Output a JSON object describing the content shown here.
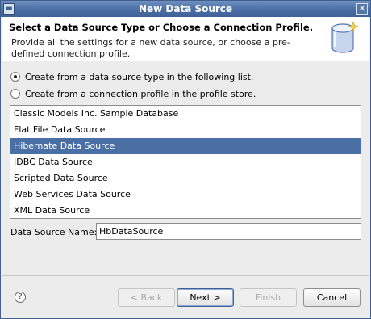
{
  "window": {
    "title": "New Data Source"
  },
  "header": {
    "heading": "Select a Data Source Type or Choose a Connection Profile.",
    "description": "Provide all the settings for a new data source, or choose a pre-defined connection profile.",
    "icon": "database-icon"
  },
  "options": {
    "create_from_type": "Create from a data source type in the following list.",
    "create_from_profile": "Create from a connection profile in the profile store.",
    "selected": "create_from_type"
  },
  "sources": {
    "items": [
      "Classic Models Inc. Sample Database",
      "Flat File Data Source",
      "Hibernate Data Source",
      "JDBC Data Source",
      "Scripted Data Source",
      "Web Services Data Source",
      "XML Data Source"
    ],
    "selected_index": 2
  },
  "name_field": {
    "label": "Data Source Name:",
    "value": "HbDataSource"
  },
  "buttons": {
    "back": "< Back",
    "next": "Next >",
    "finish": "Finish",
    "cancel": "Cancel"
  },
  "icons": {
    "help": "?"
  },
  "colors": {
    "selection": "#4a6fa5",
    "titlebar": "#4a6fa5"
  }
}
